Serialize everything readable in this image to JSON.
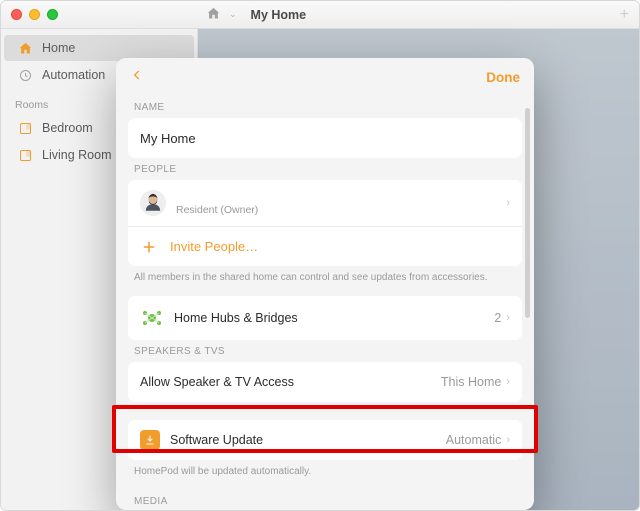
{
  "window": {
    "title": "My Home",
    "add_label": "+"
  },
  "sidebar": {
    "main": [
      {
        "label": "Home",
        "icon": "house-icon",
        "selected": true
      },
      {
        "label": "Automation",
        "icon": "clock-icon",
        "selected": false
      }
    ],
    "rooms_header": "Rooms",
    "rooms": [
      {
        "label": "Bedroom"
      },
      {
        "label": "Living Room"
      }
    ]
  },
  "sheet": {
    "done": "Done",
    "sections": {
      "name": {
        "header": "NAME",
        "value": "My Home"
      },
      "people": {
        "header": "PEOPLE",
        "resident_role": "Resident (Owner)",
        "invite": "Invite People…",
        "hint": "All members in the shared home can control and see updates from accessories."
      },
      "hubs": {
        "label": "Home Hubs & Bridges",
        "count": "2"
      },
      "speakers": {
        "header": "SPEAKERS & TVS",
        "access_label": "Allow Speaker & TV Access",
        "access_value": "This Home"
      },
      "software": {
        "label": "Software Update",
        "value": "Automatic",
        "hint": "HomePod will be updated automatically."
      },
      "media": {
        "header": "MEDIA"
      }
    }
  }
}
